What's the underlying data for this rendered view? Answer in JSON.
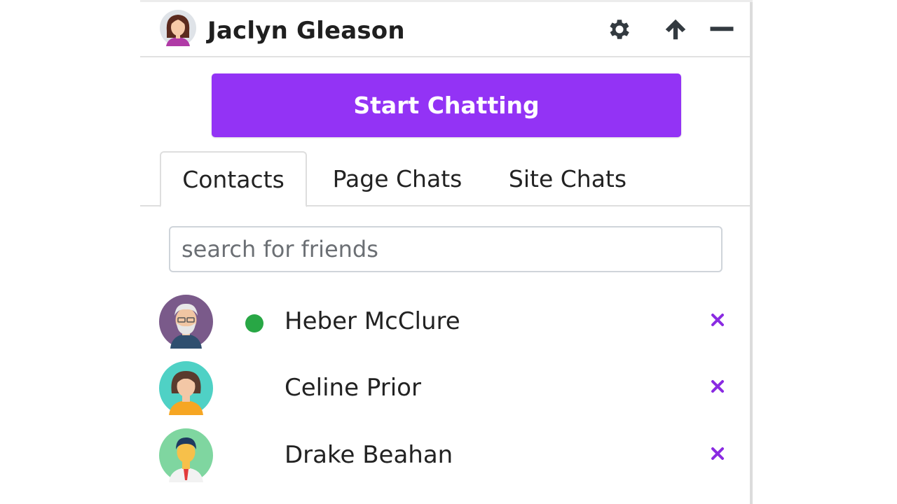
{
  "header": {
    "user_name": "Jaclyn Gleason",
    "icons": [
      "gear-icon",
      "arrow-up-icon",
      "minimize-icon"
    ]
  },
  "start_button": {
    "label": "Start Chatting"
  },
  "tabs": [
    {
      "label": "Contacts",
      "active": true
    },
    {
      "label": "Page Chats",
      "active": false
    },
    {
      "label": "Site Chats",
      "active": false
    }
  ],
  "search": {
    "placeholder": "search for friends",
    "value": ""
  },
  "contacts": [
    {
      "name": "Heber McClure",
      "online": true,
      "avatar": "elderly-man-avatar"
    },
    {
      "name": "Celine Prior",
      "online": false,
      "avatar": "woman-avatar"
    },
    {
      "name": "Drake Beahan",
      "online": false,
      "avatar": "man-avatar"
    }
  ],
  "colors": {
    "accent": "#9333f5",
    "online": "#28a745",
    "remove": "#8a2be2"
  }
}
